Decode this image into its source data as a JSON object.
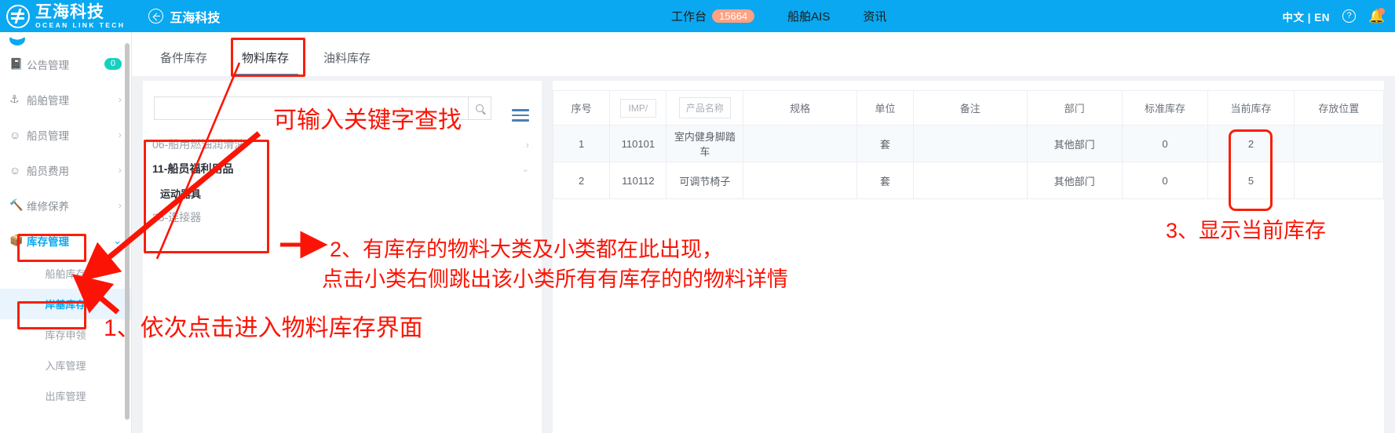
{
  "topbar": {
    "brand_cn": "互海科技",
    "brand_en": "OCEAN LINK TECH",
    "back_label": "互海科技",
    "nav": [
      {
        "label": "工作台",
        "badge": "15664"
      },
      {
        "label": "船舶AIS",
        "badge": ""
      },
      {
        "label": "资讯",
        "badge": ""
      }
    ],
    "lang": "中文 | EN",
    "help_icon": "question-icon",
    "bell_icon": "bell-icon"
  },
  "sidebar": {
    "items": [
      {
        "label": "公告管理",
        "icon": "announcement-icon",
        "badge": "0",
        "chevron": "",
        "active": false
      },
      {
        "label": "船舶管理",
        "icon": "anchor-icon",
        "badge": "",
        "chevron": "›",
        "active": false
      },
      {
        "label": "船员管理",
        "icon": "user-icon",
        "badge": "",
        "chevron": "›",
        "active": false
      },
      {
        "label": "船员费用",
        "icon": "user-icon",
        "badge": "",
        "chevron": "›",
        "active": false
      },
      {
        "label": "维修保养",
        "icon": "wrench-icon",
        "badge": "",
        "chevron": "›",
        "active": false
      },
      {
        "label": "库存管理",
        "icon": "box-icon",
        "badge": "",
        "chevron": "⌄",
        "active": true
      }
    ],
    "subitems": [
      {
        "label": "船舶库存",
        "selected": false
      },
      {
        "label": "岸基库存",
        "selected": true
      },
      {
        "label": "库存申领",
        "selected": false
      },
      {
        "label": "入库管理",
        "selected": false
      },
      {
        "label": "出库管理",
        "selected": false
      }
    ]
  },
  "tabs": [
    {
      "label": "备件库存",
      "active": false
    },
    {
      "label": "物料库存",
      "active": true
    },
    {
      "label": "油料库存",
      "active": false
    }
  ],
  "left_pane": {
    "search_value": "",
    "search_placeholder": "",
    "search_icon": "search-icon",
    "menu_icon": "hamburger-icon",
    "categories": [
      {
        "name": "06-船用燃油润滑油",
        "style": "plain",
        "chevron": "›"
      },
      {
        "name": "11-船员福利用品",
        "style": "bold",
        "chevron": "⌄"
      },
      {
        "name": "运动器具",
        "style": "sub",
        "chevron": ""
      },
      {
        "name": "35-连接器",
        "style": "plain",
        "chevron": ""
      }
    ]
  },
  "table": {
    "columns": [
      "序号",
      "IMP/",
      "产品名称",
      "规格",
      "单位",
      "备注",
      "部门",
      "标准库存",
      "当前库存",
      "存放位置"
    ],
    "header_inputs": [
      false,
      true,
      true,
      false,
      false,
      false,
      false,
      false,
      false,
      false
    ],
    "rows": [
      {
        "no": "1",
        "imp": "110101",
        "name": "室内健身脚踏车",
        "spec": "",
        "unit": "套",
        "remark": "",
        "dept": "其他部门",
        "std_stock": "0",
        "cur_stock": "2",
        "location": ""
      },
      {
        "no": "2",
        "imp": "110112",
        "name": "可调节椅子",
        "spec": "",
        "unit": "套",
        "remark": "",
        "dept": "其他部门",
        "std_stock": "0",
        "cur_stock": "5",
        "location": ""
      }
    ]
  },
  "annotations": {
    "search_hint": "可输入关键字查找",
    "note1": "1、依次点击进入物料库存界面",
    "note2_line1": "2、有库存的物料大类及小类都在此出现，",
    "note2_line2": "点击小类右侧跳出该小类所有有库存的的物料详情",
    "note3": "3、显示当前库存",
    "accent_color": "#fb1405"
  }
}
